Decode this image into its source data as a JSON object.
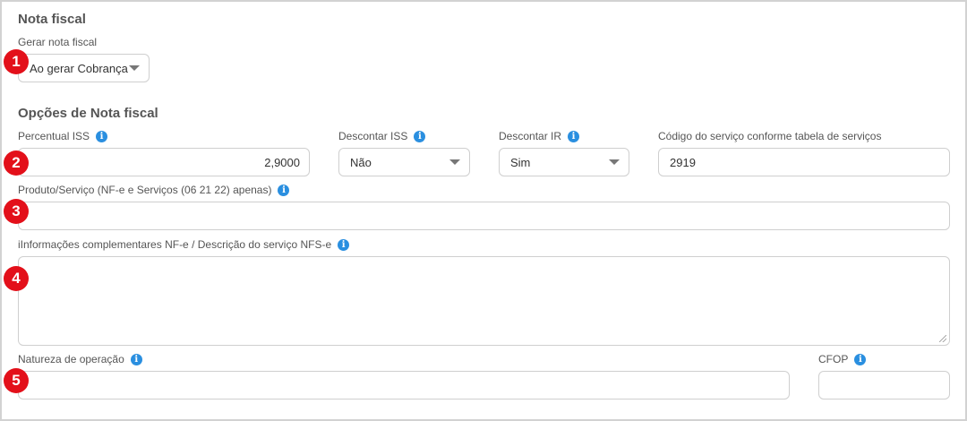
{
  "nota_fiscal": {
    "title": "Nota fiscal",
    "gerar_label": "Gerar nota fiscal",
    "gerar_value": "Ao gerar Cobrança"
  },
  "opcoes": {
    "title": "Opções de Nota fiscal",
    "percentual_iss": {
      "label": "Percentual ISS",
      "value": "2,9000"
    },
    "descontar_iss": {
      "label": "Descontar ISS",
      "value": "Não"
    },
    "descontar_ir": {
      "label": "Descontar IR",
      "value": "Sim"
    },
    "codigo_servico": {
      "label": "Código do serviço conforme tabela de serviços",
      "value": "2919"
    },
    "produto_servico": {
      "label": "Produto/Serviço (NF-e e Serviços (06 21 22) apenas)",
      "value": ""
    },
    "info_complementares": {
      "label": "iInformações complementares NF-e / Descrição do serviço NFS-e",
      "value": ""
    },
    "natureza": {
      "label": "Natureza de operação",
      "value": ""
    },
    "cfop": {
      "label": "CFOP",
      "value": ""
    }
  },
  "icons": {
    "info": "i"
  },
  "badges": [
    "1",
    "2",
    "3",
    "4",
    "5"
  ],
  "colors": {
    "badge": "#e3101a",
    "info": "#2a8fe0"
  }
}
